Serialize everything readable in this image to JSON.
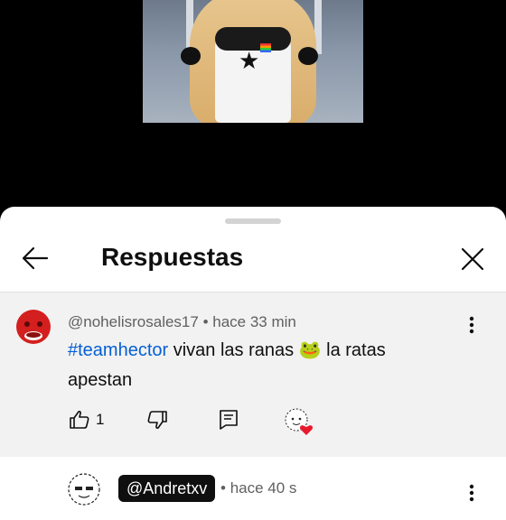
{
  "sheet": {
    "title": "Respuestas",
    "icons": {
      "back": "arrow-left-icon",
      "close": "close-icon"
    }
  },
  "comment": {
    "author": "@nohelisrosales17",
    "separator": "•",
    "time": "hace 33 min",
    "hashtag": "#teamhector",
    "text_before_emoji": " vivan las ranas ",
    "emoji": "🐸",
    "text_after_emoji": " la ratas apestan",
    "like_count": "1",
    "icons": {
      "like": "thumbs-up-icon",
      "dislike": "thumbs-down-icon",
      "reply": "reply-icon",
      "more": "more-vertical-icon",
      "creator_heart": "creator-heart-avatar"
    },
    "colors": {
      "hashtag": "#065fd4",
      "avatar": "#d41f1f",
      "heart": "#e8192c"
    }
  },
  "reply": {
    "author_mention": "@Andretxv",
    "separator": "•",
    "time": "hace 40 s",
    "icons": {
      "more": "more-vertical-icon"
    }
  }
}
